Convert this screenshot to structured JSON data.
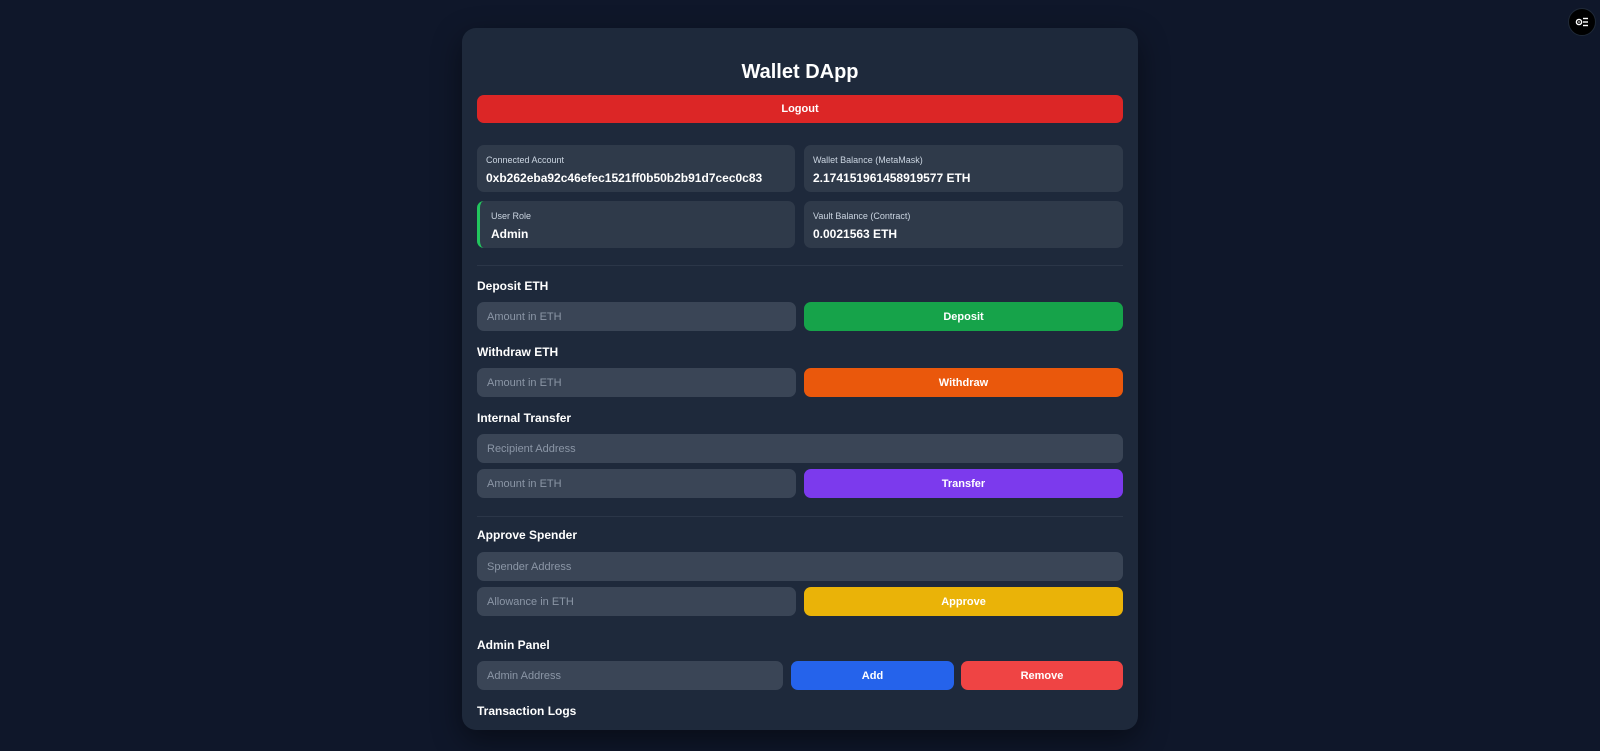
{
  "app": {
    "title": "Wallet DApp",
    "logout_label": "Logout"
  },
  "info": {
    "account_label": "Connected Account",
    "account_value": "0xb262eba92c46efec1521ff0b50b2b91d7cec0c83",
    "wallet_label": "Wallet Balance (MetaMask)",
    "wallet_value": "2.174151961458919577 ETH",
    "role_label": "User Role",
    "role_value": "Admin",
    "vault_label": "Vault Balance (Contract)",
    "vault_value": "0.0021563 ETH"
  },
  "deposit": {
    "heading": "Deposit ETH",
    "placeholder": "Amount in ETH",
    "button": "Deposit"
  },
  "withdraw": {
    "heading": "Withdraw ETH",
    "placeholder": "Amount in ETH",
    "button": "Withdraw"
  },
  "transfer": {
    "heading": "Internal Transfer",
    "recipient_placeholder": "Recipient Address",
    "amount_placeholder": "Amount in ETH",
    "button": "Transfer"
  },
  "approve": {
    "heading": "Approve Spender",
    "spender_placeholder": "Spender Address",
    "allowance_placeholder": "Allowance in ETH",
    "button": "Approve"
  },
  "admin": {
    "heading": "Admin Panel",
    "placeholder": "Admin Address",
    "add_button": "Add",
    "remove_button": "Remove"
  },
  "logs": {
    "heading": "Transaction Logs"
  },
  "icons": {
    "corner": "settings-list-icon"
  },
  "colors": {
    "logout": "#dc2626",
    "deposit": "#16a34a",
    "withdraw": "#ea580c",
    "transfer": "#7c3aed",
    "approve": "#eab308",
    "add": "#2563eb",
    "remove": "#ef4444",
    "role_accent": "#22c55e"
  }
}
